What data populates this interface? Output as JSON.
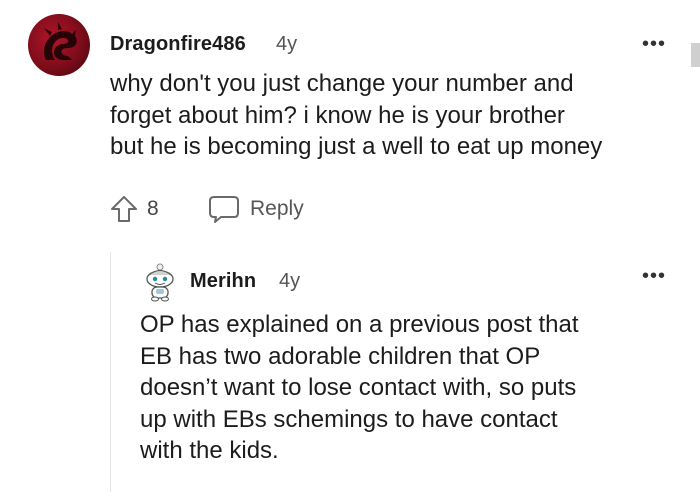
{
  "comment": {
    "username": "Dragonfire486",
    "age": "4y",
    "lines": [
      "why don't you just change your number and",
      "forget about him? i know he is your brother",
      "but he is becoming just a well to eat up money"
    ],
    "vote_count": "8",
    "reply_label": "Reply",
    "more_label": "•••"
  },
  "reply": {
    "username": "Merihn",
    "age": "4y",
    "lines": [
      "OP has explained on a previous post that",
      "EB has two adorable children that OP",
      "doesn’t want to lose contact with, so puts",
      "up with EBs schemings to have contact",
      "with the kids."
    ],
    "more_label": "•••"
  },
  "icons": {
    "upvote": "upvote-arrow-icon",
    "reply": "speech-bubble-icon",
    "more": "more-options-icon"
  }
}
